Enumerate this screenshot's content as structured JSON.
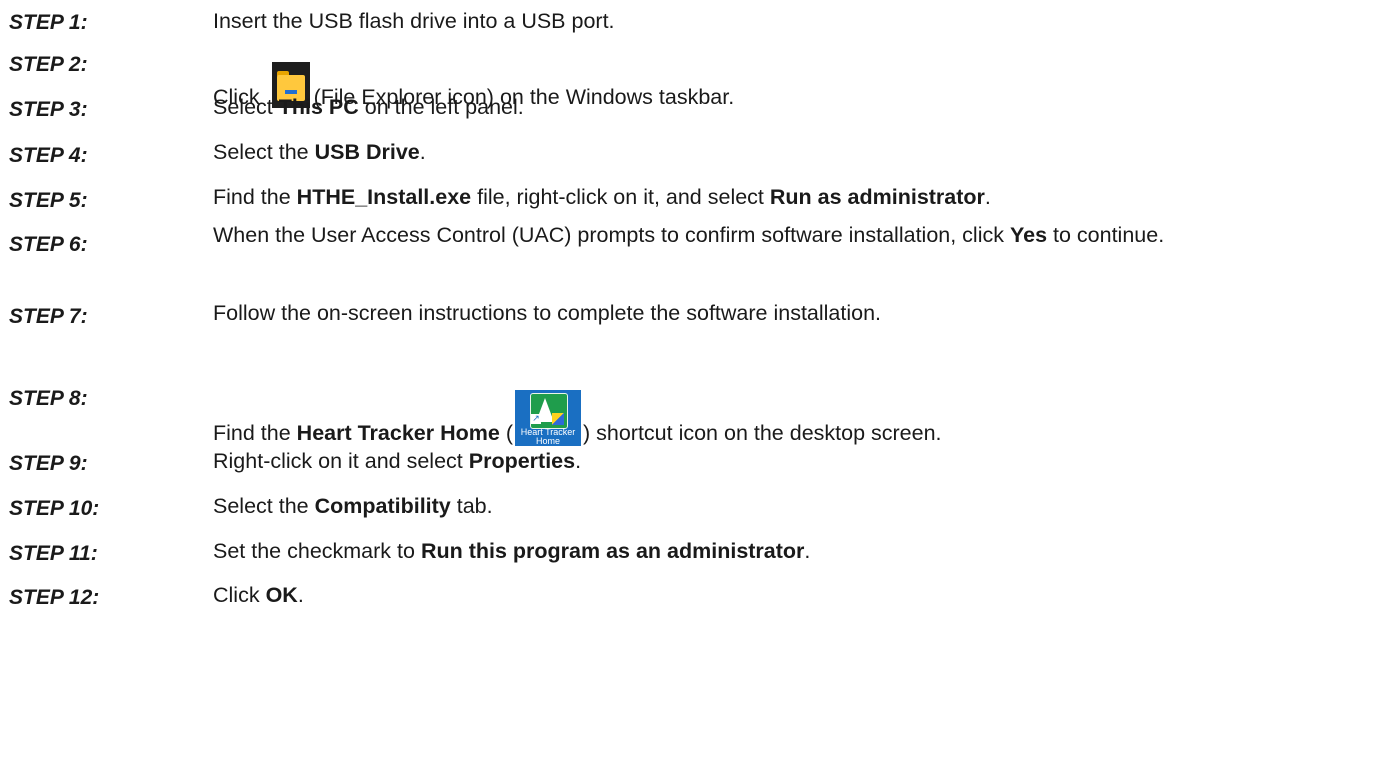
{
  "steps": [
    {
      "label": "STEP 1:",
      "segments": [
        {
          "t": "Insert the USB flash drive into a USB port."
        }
      ]
    },
    {
      "label": "STEP 2:",
      "segments": [
        {
          "t": "Click "
        },
        {
          "icon": "file-explorer-icon"
        },
        {
          "t": "(File Explorer icon) on the Windows taskbar."
        }
      ]
    },
    {
      "label": "STEP 3:",
      "segments": [
        {
          "t": "Select "
        },
        {
          "b": "This PC"
        },
        {
          "t": " on the left panel."
        }
      ]
    },
    {
      "label": "STEP 4:",
      "segments": [
        {
          "t": "Select the "
        },
        {
          "b": "USB Drive"
        },
        {
          "t": "."
        }
      ]
    },
    {
      "label": "STEP 5:",
      "segments": [
        {
          "t": "Find the "
        },
        {
          "b": "HTHE_Install.exe"
        },
        {
          "t": " file, right-click on it, and select "
        },
        {
          "b": "Run as administrator"
        },
        {
          "t": "."
        }
      ]
    },
    {
      "label": "STEP 6:",
      "segments": [
        {
          "t": "When the User Access Control (UAC) prompts to confirm software installation, click "
        },
        {
          "b": "Yes"
        },
        {
          "t": " to continue."
        }
      ]
    },
    {
      "label": "STEP 7:",
      "segments": [
        {
          "t": "Follow the on-screen instructions to complete the software installation."
        }
      ]
    },
    {
      "label": "STEP 8:",
      "segments": [
        {
          "t": "Find the "
        },
        {
          "b": "Heart Tracker Home"
        },
        {
          "t": " ("
        },
        {
          "icon": "heart-tracker-home-icon"
        },
        {
          "t": ") shortcut icon on the desktop screen."
        }
      ]
    },
    {
      "label": "STEP 9:",
      "segments": [
        {
          "t": "Right-click on it and select "
        },
        {
          "b": "Properties"
        },
        {
          "t": "."
        }
      ]
    },
    {
      "label": "STEP 10:",
      "segments": [
        {
          "t": "Select the "
        },
        {
          "b": "Compatibility"
        },
        {
          "t": " tab."
        }
      ]
    },
    {
      "label": "STEP 11:",
      "segments": [
        {
          "t": "Set the checkmark to "
        },
        {
          "b": "Run this program as an administrator"
        },
        {
          "t": "."
        }
      ]
    },
    {
      "label": "STEP 12:",
      "segments": [
        {
          "t": "Click "
        },
        {
          "b": "OK"
        },
        {
          "t": "."
        }
      ]
    }
  ],
  "icons": {
    "heart_tracker_caption_1": "Heart Tracker",
    "heart_tracker_caption_2": "Home"
  }
}
